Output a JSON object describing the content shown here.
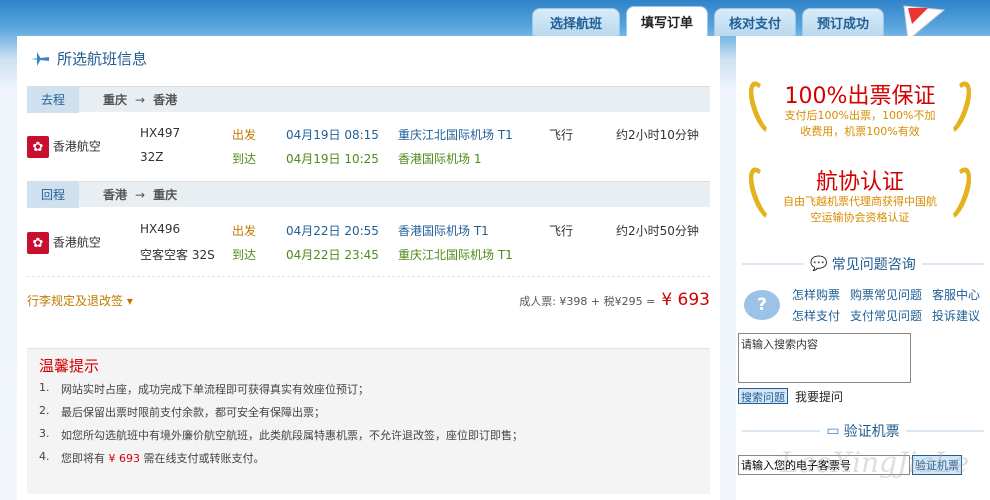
{
  "tabs": [
    {
      "label": "选择航班"
    },
    {
      "label": "填写订单"
    },
    {
      "label": "核对支付"
    },
    {
      "label": "预订成功"
    }
  ],
  "section_title": "所选航班信息",
  "outbound": {
    "tag": "去程",
    "from": "重庆",
    "arrow": "→",
    "to": "香港",
    "airline": "香港航空",
    "flight_no": "HX497",
    "cabin": "32Z",
    "depart_label": "出发",
    "arrive_label": "到达",
    "depart_time": "04月19日 08:15",
    "arrive_time": "04月19日 10:25",
    "depart_airport": "重庆江北国际机场 T1",
    "arrive_airport": "香港国际机场 1",
    "fly_label": "飞行",
    "duration": "约2小时10分钟"
  },
  "return": {
    "tag": "回程",
    "from": "香港",
    "arrow": "→",
    "to": "重庆",
    "airline": "香港航空",
    "flight_no": "HX496",
    "cabin": "空客空客 32S",
    "depart_label": "出发",
    "arrive_label": "到达",
    "depart_time": "04月22日 20:55",
    "arrive_time": "04月22日 23:45",
    "depart_airport": "香港国际机场 T1",
    "arrive_airport": "重庆江北国际机场 T1",
    "fly_label": "飞行",
    "duration": "约2小时50分钟"
  },
  "luggage_link": "行李规定及退改签 ▾",
  "price": {
    "breakdown": "成人票:  ¥398 + 税¥295 =",
    "total": "¥ 693"
  },
  "tips": {
    "title": "温馨提示",
    "items": [
      {
        "n": "1.",
        "text": "网站实时占座，成功完成下单流程即可获得真实有效座位预订；"
      },
      {
        "n": "2.",
        "text": "最后保留出票时限前支付余款，都可安全有保障出票；"
      },
      {
        "n": "3.",
        "text": "如您所勾选航班中有境外廉价航空航班，此类航段属特惠机票，不允许退改签，座位即订即售；"
      },
      {
        "n": "4.",
        "pre": "您即将有",
        "amount": "¥ 693",
        "post": "需在线支付或转账支付。"
      }
    ]
  },
  "badge1": {
    "title": "100%出票保证",
    "desc": "支付后100%出票，100%不加收费用，机票100%有效"
  },
  "badge2": {
    "title": "航协认证",
    "desc": "自由飞越机票代理商获得中国航空运输协会资格认证"
  },
  "faq": {
    "title": "常见问题咨询",
    "links_row1": [
      "怎样购票",
      "购票常见问题",
      "客服中心"
    ],
    "links_row2": [
      "怎样支付",
      "支付常见问题",
      "投诉建议"
    ],
    "search_placeholder": "请输入搜索内容",
    "search_button": "搜索问题",
    "ask_link": "我要提问"
  },
  "verify": {
    "title": "验证机票",
    "input_placeholder": "请输入您的电子客票号",
    "button": "验证机票"
  },
  "watermark": "LaoXingJiaLe",
  "colors": {
    "accent": "#1f5f96",
    "price_red": "#d40000",
    "green": "#4e8a18",
    "gold": "#e3b21c"
  }
}
